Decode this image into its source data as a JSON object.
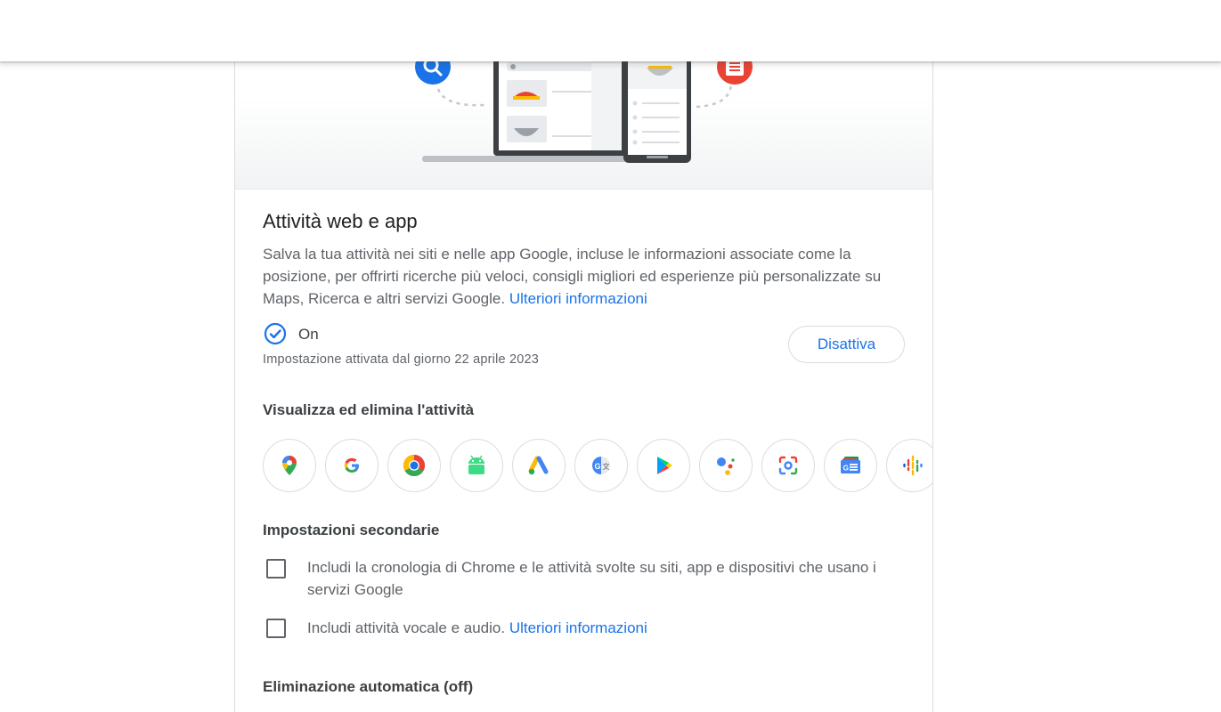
{
  "section": {
    "title": "Attività web e app",
    "description": "Salva la tua attività nei siti e nelle app Google, incluse le informazioni associate come la posizione, per offrirti ricerche più veloci, consigli migliori ed esperienze più personalizzate su Maps, Ricerca e altri servizi Google.",
    "learn_more": "Ulteriori informazioni"
  },
  "status": {
    "label": "On",
    "date_text": "Impostazione attivata dal giorno 22 aprile 2023",
    "button_label": "Disattiva"
  },
  "view_delete": {
    "title": "Visualizza ed elimina l'attività",
    "apps": [
      "maps-icon",
      "google-icon",
      "chrome-icon",
      "android-icon",
      "google-ads-icon",
      "google-translate-icon",
      "google-play-icon",
      "google-assistant-icon",
      "google-lens-icon",
      "google-news-icon",
      "google-podcasts-icon"
    ]
  },
  "secondary": {
    "title": "Impostazioni secondarie",
    "chrome_history": "Includi la cronologia di Chrome e le attività svolte su siti, app e dispositivi che usano i servizi Google",
    "voice_audio": "Includi attività vocale e audio.",
    "voice_learn_more": "Ulteriori informazioni"
  },
  "auto_delete": {
    "title": "Eliminazione automatica (off)"
  },
  "colors": {
    "accent": "#1a73e8",
    "text": "#3c4043",
    "secondary_text": "#5f6368",
    "border": "#dadce0"
  }
}
